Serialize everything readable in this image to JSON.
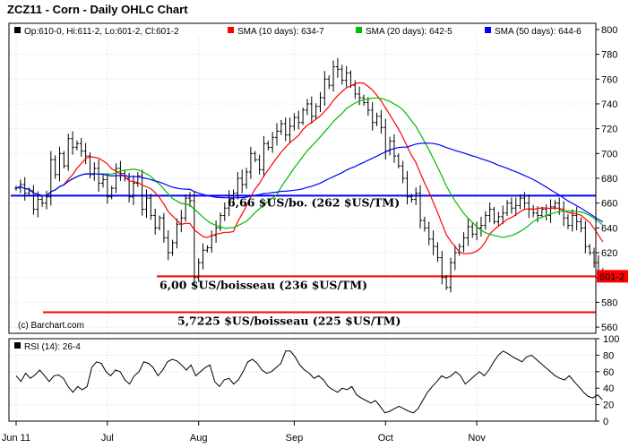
{
  "chart_data": {
    "type": "ohlc",
    "title": "ZCZ11 - Corn - Daily OHLC Chart",
    "legend": {
      "ohlc": "Op:610-0, Hi:611-2, Lo:601-2, Cl:601-2",
      "sma": [
        {
          "label": "SMA (10 days): 634-7",
          "color": "#ff0000"
        },
        {
          "label": "SMA (20 days): 642-5",
          "color": "#00bb00"
        },
        {
          "label": "SMA (50 days): 644-6",
          "color": "#0000ff"
        }
      ]
    },
    "price_axis": {
      "ylim": [
        555,
        805
      ],
      "ticks": [
        "800",
        "780",
        "760",
        "740",
        "720",
        "700",
        "680",
        "660",
        "640",
        "620",
        "600",
        "580",
        "560"
      ],
      "last_label": "601-2"
    },
    "rsi_axis": {
      "ylim": [
        0,
        100
      ],
      "ticks": [
        "100",
        "80",
        "60",
        "40",
        "20",
        "0"
      ],
      "label": "RSI (14): 26-4"
    },
    "x_axis": {
      "months": [
        {
          "label": "Jun 11",
          "day": 0
        },
        {
          "label": "Jul",
          "day": 21
        },
        {
          "label": "Aug",
          "day": 42
        },
        {
          "label": "Sep",
          "day": 64
        },
        {
          "label": "Oct",
          "day": 85
        },
        {
          "label": "Nov",
          "day": 106
        }
      ]
    },
    "watermark": "(c) Barchart.com",
    "horizontal_lines": [
      {
        "value": 666,
        "color": "#0000ff",
        "label": "6,66 $US/bo. (262 $US/TM)"
      },
      {
        "value": 601,
        "color": "#ff0000",
        "label": "6,00 $US/boisseau (236 $US/TM)"
      },
      {
        "value": 572,
        "color": "#ff0000",
        "label": "5,7225 $US/boisseau (225 $US/TM)"
      }
    ],
    "closes": [
      672,
      675,
      668,
      670,
      655,
      663,
      660,
      665,
      695,
      683,
      700,
      690,
      712,
      705,
      708,
      702,
      698,
      683,
      688,
      676,
      679,
      665,
      672,
      688,
      684,
      680,
      665,
      676,
      682,
      655,
      664,
      650,
      640,
      648,
      632,
      620,
      628,
      643,
      648,
      664,
      662,
      600,
      612,
      622,
      624,
      634,
      640,
      650,
      656,
      664,
      668,
      680,
      675,
      685,
      700,
      695,
      687,
      708,
      705,
      713,
      718,
      724,
      715,
      722,
      729,
      725,
      735,
      740,
      730,
      738,
      745,
      760,
      755,
      770,
      768,
      759,
      765,
      755,
      748,
      745,
      741,
      735,
      725,
      730,
      721,
      702,
      710,
      698,
      690,
      680,
      665,
      663,
      668,
      646,
      640,
      631,
      625,
      616,
      600,
      592,
      612,
      620,
      625,
      632,
      641,
      635,
      640,
      642,
      650,
      655,
      645,
      649,
      652,
      660,
      656,
      658,
      664,
      660,
      655,
      652,
      650,
      655,
      650,
      657,
      660,
      655,
      648,
      642,
      650,
      645,
      640,
      625,
      620,
      612,
      605,
      601
    ],
    "rsi": [
      55,
      48,
      58,
      52,
      56,
      62,
      55,
      48,
      55,
      56,
      52,
      42,
      35,
      42,
      38,
      42,
      65,
      72,
      70,
      60,
      55,
      62,
      60,
      50,
      45,
      55,
      60,
      72,
      70,
      65,
      55,
      62,
      72,
      75,
      73,
      68,
      62,
      68,
      55,
      60,
      65,
      68,
      48,
      42,
      50,
      52,
      45,
      50,
      60,
      72,
      75,
      70,
      62,
      58,
      60,
      65,
      70,
      85,
      85,
      78,
      68,
      62,
      58,
      52,
      55,
      50,
      42,
      38,
      35,
      40,
      38,
      42,
      32,
      28,
      25,
      22,
      25,
      18,
      10,
      12,
      15,
      18,
      15,
      12,
      10,
      15,
      25,
      35,
      42,
      48,
      55,
      52,
      55,
      60,
      55,
      45,
      50,
      55,
      60,
      55,
      62,
      72,
      80,
      85,
      82,
      78,
      75,
      72,
      78,
      80,
      75,
      70,
      65,
      60,
      55,
      52,
      50,
      55,
      48,
      42,
      35,
      30,
      28,
      32,
      26
    ]
  }
}
